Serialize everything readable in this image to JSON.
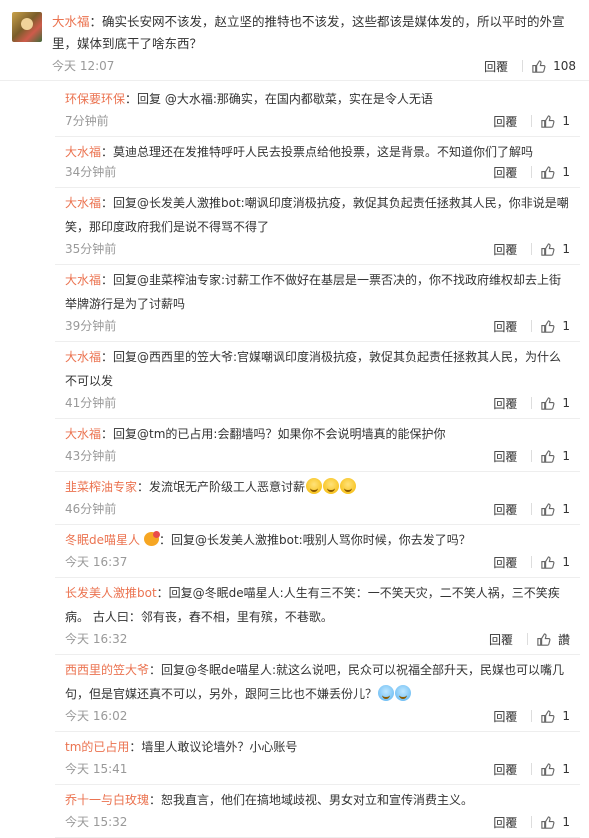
{
  "main_comment": {
    "user": "大水福",
    "text": "：确实长安网不该发，赵立坚的推特也不该发，这些都该是媒体发的，所以平时的外宣里，媒体到底干了啥东西？",
    "time": "今天 12:07",
    "reply_label": "回覆",
    "likes": "108"
  },
  "replies": [
    {
      "user": "环保要环保",
      "text": "：回复 @大水福:那确实，在国内都歇菜，实在是令人无语",
      "time": "7分钟前",
      "reply_label": "回覆",
      "likes": "1"
    },
    {
      "user": "大水福",
      "text": "：莫迪总理还在发推特呼吁人民去投票点给他投票，这是背景。不知道你们了解吗",
      "time": "34分钟前",
      "reply_label": "回覆",
      "likes": "1"
    },
    {
      "user": "大水福",
      "text": "：回复@长发美人激推bot:嘲讽印度消极抗疫，敦促其负起责任拯救其人民，你非说是嘲笑，那印度政府我们是说不得骂不得了",
      "time": "35分钟前",
      "reply_label": "回覆",
      "likes": "1"
    },
    {
      "user": "大水福",
      "text": "：回复@韭菜榨油专家:讨薪工作不做好在基层是一票否决的，你不找政府维权却去上街举牌游行是为了讨薪吗",
      "time": "39分钟前",
      "reply_label": "回覆",
      "likes": "1"
    },
    {
      "user": "大水福",
      "text": "：回复@西西里的笠大爷:官媒嘲讽印度消极抗疫，敦促其负起责任拯救其人民，为什么不可以发",
      "time": "41分钟前",
      "reply_label": "回覆",
      "likes": "1"
    },
    {
      "user": "大水福",
      "text": "：回复@tm的已占用:会翻墙吗？如果你不会说明墙真的能保护你",
      "time": "43分钟前",
      "reply_label": "回覆",
      "likes": "1"
    },
    {
      "user": "韭菜榨油专家",
      "text": "：发流氓无产阶级工人恶意讨薪",
      "time": "46分钟前",
      "reply_label": "回覆",
      "likes": "1",
      "emoji": 3
    },
    {
      "user": "冬眠de喵星人",
      "text": "：回复@长发美人激推bot:哦别人骂你时候，你去发了吗？",
      "time": "今天 16:37",
      "reply_label": "回覆",
      "likes": "1",
      "badge": true
    },
    {
      "user": "长发美人激推bot",
      "text": "：回复@冬眠de喵星人:人生有三不笑：一不笑天灾，二不笑人祸，三不笑疾病。 古人曰：邻有丧，舂不相，里有殡，不巷歌。",
      "time": "今天 16:32",
      "reply_label": "回覆",
      "likes": "讚"
    },
    {
      "user": "西西里的笠大爷",
      "text": "：回复@冬眠de喵星人:就这么说吧，民众可以祝福全部升天，民媒也可以嘴几句，但是官媒还真不可以，另外，跟阿三比也不嫌丢份儿？",
      "time": "今天 16:02",
      "reply_label": "回覆",
      "likes": "1",
      "emoji_tear": 2
    },
    {
      "user": "tm的已占用",
      "text": "：墙里人敢议论墙外？小心账号",
      "time": "今天 15:41",
      "reply_label": "回覆",
      "likes": "1"
    },
    {
      "user": "乔十一与白玫瑰",
      "text": "：恕我直言，他们在搞地域歧视、男女对立和宣传消费主义。",
      "time": "今天 15:32",
      "reply_label": "回覆",
      "likes": "1"
    }
  ]
}
